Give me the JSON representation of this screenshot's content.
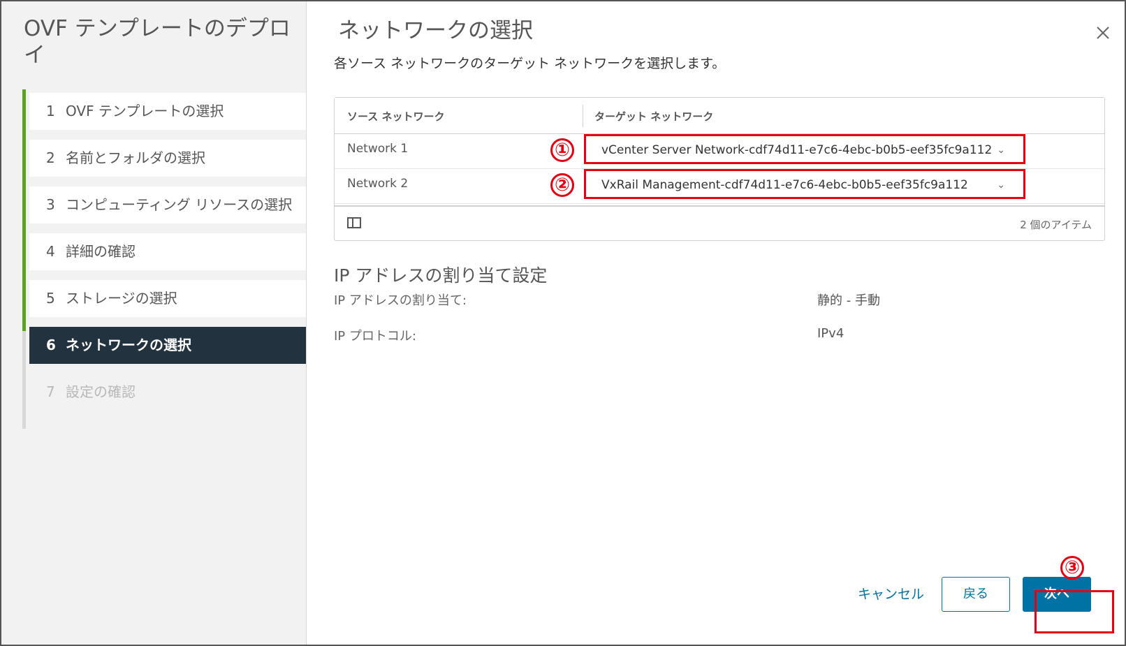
{
  "wizard": {
    "title": "OVF テンプレートのデプロイ",
    "steps": [
      {
        "num": "1",
        "label": "OVF テンプレートの選択"
      },
      {
        "num": "2",
        "label": "名前とフォルダの選択"
      },
      {
        "num": "3",
        "label": "コンピューティング リソースの選択"
      },
      {
        "num": "4",
        "label": "詳細の確認"
      },
      {
        "num": "5",
        "label": "ストレージの選択"
      },
      {
        "num": "6",
        "label": "ネットワークの選択"
      },
      {
        "num": "7",
        "label": "設定の確認"
      }
    ]
  },
  "page": {
    "title": "ネットワークの選択",
    "subtitle": "各ソース ネットワークのターゲット ネットワークを選択します。"
  },
  "grid": {
    "headers": {
      "source": "ソース ネットワーク",
      "target": "ターゲット ネットワーク"
    },
    "rows": [
      {
        "source": "Network 1",
        "target": "vCenter Server Network-cdf74d11-e7c6-4ebc-b0b5-eef35fc9a112"
      },
      {
        "source": "Network 2",
        "target": "VxRail Management-cdf74d11-e7c6-4ebc-b0b5-eef35fc9a112"
      }
    ],
    "footer_count": "2 個のアイテム"
  },
  "annotations": {
    "m1": "①",
    "m2": "②",
    "m3": "③",
    "color": "#e60012"
  },
  "ip": {
    "section_title": "IP アドレスの割り当て設定",
    "alloc_label": "IP アドレスの割り当て:",
    "alloc_value": "静的 - 手動",
    "protocol_label": "IP プロトコル:",
    "protocol_value": "IPv4"
  },
  "footer": {
    "cancel": "キャンセル",
    "back": "戻る",
    "next": "次へ"
  },
  "colors": {
    "accent": "#0072a3",
    "active_step_bg": "#22323e",
    "progress": "#5aa220"
  }
}
